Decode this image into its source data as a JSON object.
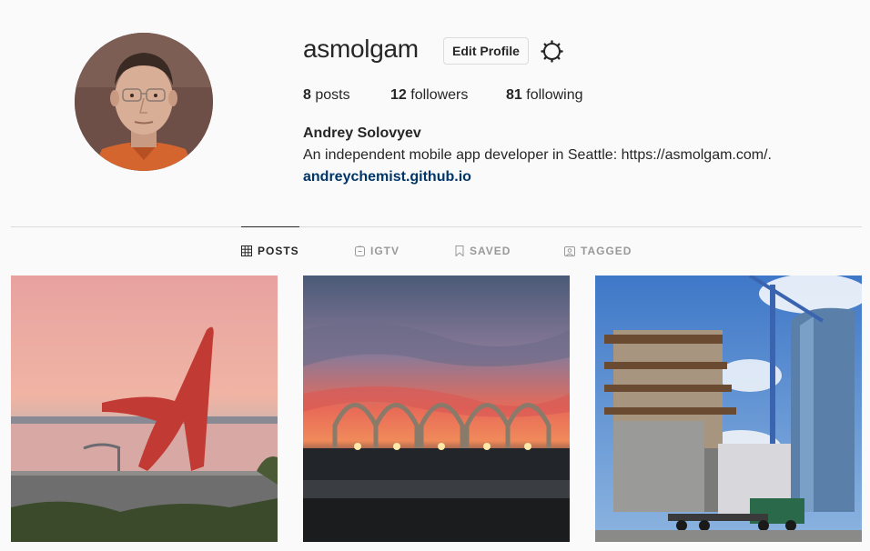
{
  "profile": {
    "username": "asmolgam",
    "edit_label": "Edit Profile",
    "posts_count": "8",
    "posts_label": "posts",
    "followers_count": "12",
    "followers_label": "followers",
    "following_count": "81",
    "following_label": "following",
    "full_name": "Andrey Solovyev",
    "bio": "An independent mobile app developer in Seattle: https://asmolgam.com/.",
    "website": "andreychemist.github.io"
  },
  "tabs": [
    {
      "label": "POSTS",
      "icon": "grid-icon",
      "active": true
    },
    {
      "label": "IGTV",
      "icon": "igtv-icon",
      "active": false
    },
    {
      "label": "SAVED",
      "icon": "bookmark-icon",
      "active": false
    },
    {
      "label": "TAGGED",
      "icon": "tagged-icon",
      "active": false
    }
  ],
  "colors": {
    "text": "#262626",
    "muted": "#999999",
    "link": "#003569",
    "border": "#dbdbdb",
    "background": "#fafafa"
  }
}
